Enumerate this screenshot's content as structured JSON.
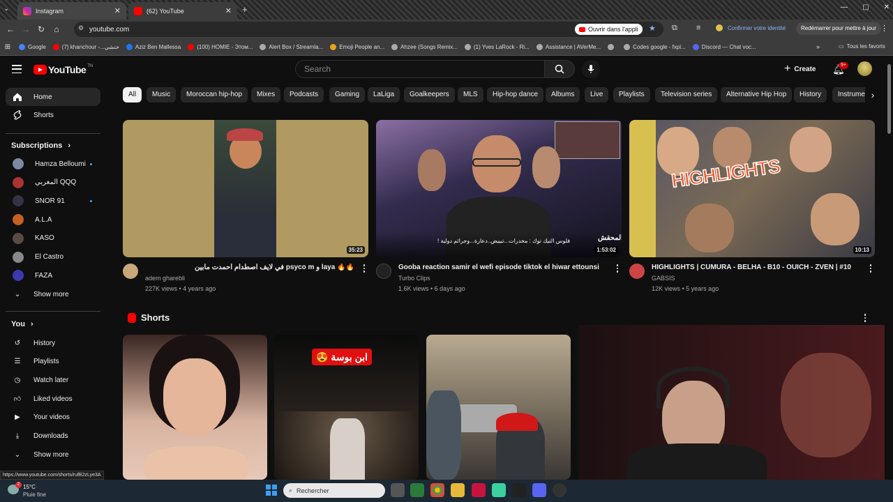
{
  "browser": {
    "tabs": [
      {
        "title": "Instagram",
        "color": "#d6249f"
      },
      {
        "title": "(62) YouTube",
        "color": "#ff0000"
      }
    ],
    "url": "youtube.com",
    "open_in_app": "Ouvrir dans l'appli",
    "confirm_identity": "Confirmer votre identité",
    "restart_update": "Redémarrer pour mettre à jour",
    "bookmarks": [
      {
        "label": "Google",
        "color": "#4285f4"
      },
      {
        "label": "(7) khanchour -...خنشي",
        "color": "#ff0000"
      },
      {
        "label": "Aziz Ben Mallessa",
        "color": "#1877f2"
      },
      {
        "label": "(100) HOMIE - Этом...",
        "color": "#ff0000"
      },
      {
        "label": "Alert Box / Streamla...",
        "color": "#aaaaaa"
      },
      {
        "label": "Emoji People an...",
        "color": "#e8a317"
      },
      {
        "label": "Ahzee (Songs Remix...",
        "color": "#aaaaaa"
      },
      {
        "label": "(1) Yves LaRock - Ri...",
        "color": "#aaaaaa"
      },
      {
        "label": "Assistance | AVerMe...",
        "color": "#aaaaaa"
      },
      {
        "label": "",
        "color": "#aaaaaa"
      },
      {
        "label": "Codes google - fxpi...",
        "color": "#aaaaaa"
      },
      {
        "label": "Discord — Chat voc...",
        "color": "#5865f2"
      }
    ],
    "all_bookmarks": "Tous les favoris"
  },
  "header": {
    "logo": "YouTube",
    "logo_country": "TN",
    "search_placeholder": "Search",
    "create_label": "Create",
    "notif_count": "9+"
  },
  "sidebar": {
    "home": "Home",
    "shorts": "Shorts",
    "subscriptions_label": "Subscriptions",
    "subscriptions": [
      {
        "name": "Hamza Belloumi",
        "color": "#7a8aa0",
        "dot": true
      },
      {
        "name": "المغربي QQQ",
        "color": "#a33",
        "dot": false
      },
      {
        "name": "SNOR 91",
        "color": "#334",
        "dot": true
      },
      {
        "name": "A.L.A",
        "color": "#c55f22",
        "dot": false
      },
      {
        "name": "KASO",
        "color": "#5a4a44",
        "dot": false
      },
      {
        "name": "El Castro",
        "color": "#888",
        "dot": false
      },
      {
        "name": "FAZA",
        "color": "#3a3ab0",
        "dot": false
      }
    ],
    "show_more": "Show more",
    "you_label": "You",
    "you_items": [
      {
        "label": "History",
        "icon": "history-icon"
      },
      {
        "label": "Playlists",
        "icon": "playlists-icon"
      },
      {
        "label": "Watch later",
        "icon": "watch-later-icon"
      },
      {
        "label": "Liked videos",
        "icon": "liked-icon"
      },
      {
        "label": "Your videos",
        "icon": "your-videos-icon"
      },
      {
        "label": "Downloads",
        "icon": "downloads-icon"
      }
    ],
    "show_more_2": "Show more"
  },
  "chips": [
    "All",
    "Music",
    "Moroccan hip-hop",
    "Mixes",
    "Podcasts",
    "Gaming",
    "LaLiga",
    "Goalkeepers",
    "MLS",
    "Hip-hop dance",
    "Albums",
    "Live",
    "Playlists",
    "Television series",
    "Alternative Hip Hop",
    "History",
    "Instrumental"
  ],
  "videos": [
    {
      "title": "🔥🔥 laya و psyco m في لايف اصطدام أحمدت مابين",
      "channel": "adem gharebli",
      "meta": "227K views • 4 years ago",
      "duration": "35:23"
    },
    {
      "title": "Gooba reaction samir el wefi episode tiktok el hiwar ettounsi",
      "channel": "Turbo Clips",
      "meta": "1.6K views • 6 days ago",
      "duration": "1:53:02",
      "overlay": "فلوس التيك توك : مخدرات...تبييض..دعارة...وجرائم دولية !",
      "logo": "المحقش"
    },
    {
      "title": "HIGHLIGHTS | CUMURA - BELHA - B10 - OUICH - ZVEN | #10",
      "channel": "GABSIS",
      "meta": "12K views • 5 years ago",
      "duration": "10:13",
      "overlay": "HIGHLIGHTS"
    }
  ],
  "shorts_section": {
    "title": "Shorts",
    "short2_overlay": "ابن بوسة 😍"
  },
  "status_url": "https://www.youtube.com/shorts/rufB2zLye3A",
  "taskbar": {
    "weather_temp": "15°C",
    "weather_desc": "Pluie fine",
    "search": "Rechercher",
    "badge": "2"
  }
}
